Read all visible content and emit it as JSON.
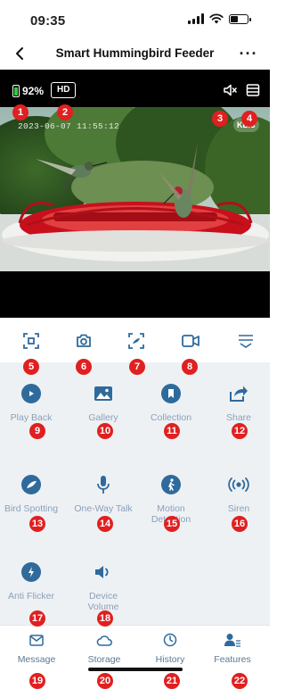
{
  "status_bar": {
    "time": "09:35"
  },
  "nav": {
    "title": "Smart Hummingbird Feeder",
    "more_label": "···"
  },
  "player": {
    "battery_percent": "92%",
    "quality_label": "HD",
    "timestamp": "2023-06-07 11:55:12",
    "speed_label": "KB/s"
  },
  "toolbar": {
    "icons": [
      "focus-icon",
      "camera-icon",
      "scan-icon",
      "video-record-icon",
      "menu-icon"
    ]
  },
  "features": {
    "items": [
      {
        "label": "Play Back",
        "icon": "play-icon"
      },
      {
        "label": "Gallery",
        "icon": "image-icon"
      },
      {
        "label": "Collection",
        "icon": "bookmark-icon"
      },
      {
        "label": "Share",
        "icon": "share-icon"
      },
      {
        "label": "Bird Spotting",
        "icon": "bird-icon"
      },
      {
        "label": "One-Way Talk",
        "icon": "microphone-icon"
      },
      {
        "label": "Motion Detection",
        "icon": "walking-person-icon"
      },
      {
        "label": "Siren",
        "icon": "siren-icon"
      },
      {
        "label": "Anti Flicker",
        "icon": "lightning-icon"
      },
      {
        "label": "Device Volume",
        "icon": "speaker-icon"
      }
    ]
  },
  "tabs": [
    {
      "label": "Message",
      "icon": "envelope-icon"
    },
    {
      "label": "Storage",
      "icon": "cloud-icon"
    },
    {
      "label": "History",
      "icon": "clock-icon"
    },
    {
      "label": "Features",
      "icon": "user-features-icon"
    }
  ],
  "markers": [
    "1",
    "2",
    "3",
    "4",
    "5",
    "6",
    "7",
    "8",
    "9",
    "10",
    "11",
    "12",
    "13",
    "14",
    "15",
    "16",
    "17",
    "18",
    "19",
    "20",
    "21",
    "22"
  ],
  "colors": {
    "accent": "#2f6a9c",
    "marker": "#e02020",
    "feature_bg": "#eef1f4",
    "label": "#8aa0b8",
    "battery_green": "#2ecc40"
  }
}
